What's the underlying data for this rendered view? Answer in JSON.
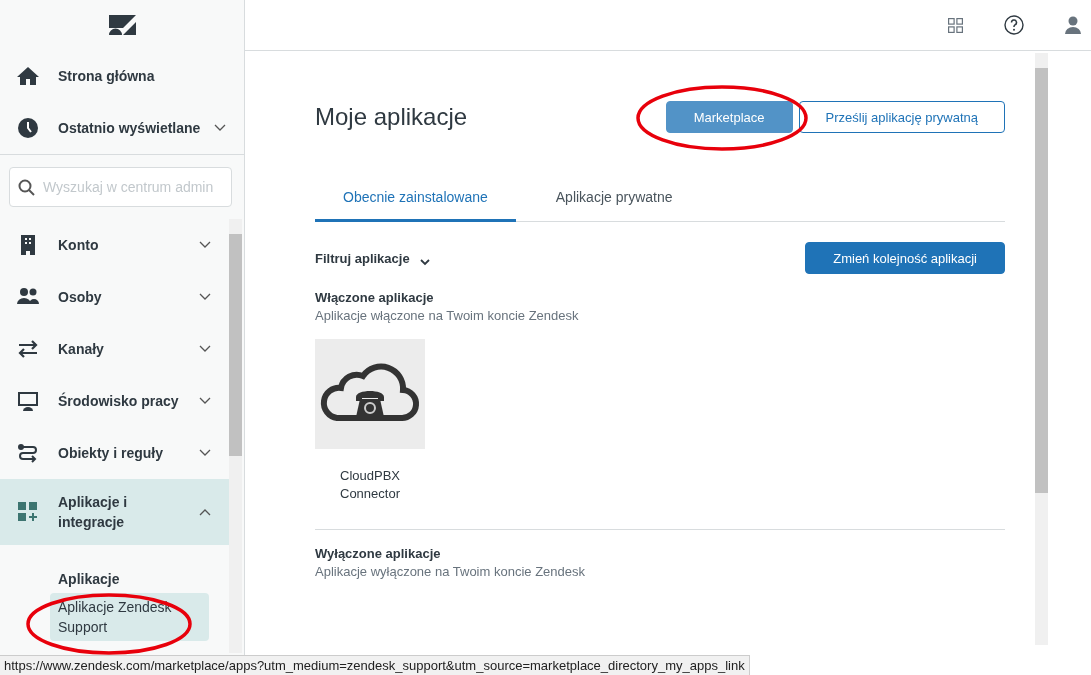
{
  "sidebar": {
    "top_items": [
      {
        "label": "Strona główna",
        "kind": "link"
      },
      {
        "label": "Ostatnio wyświetlane",
        "kind": "group",
        "expanded": false
      }
    ],
    "search": {
      "placeholder": "Wyszukaj w centrum admin"
    },
    "items": [
      {
        "label": "Konto",
        "expanded": false
      },
      {
        "label": "Osoby",
        "expanded": false
      },
      {
        "label": "Kanały",
        "expanded": false
      },
      {
        "label": "Środowisko pracy",
        "expanded": false
      },
      {
        "label": "Obiekty i reguły",
        "expanded": false
      },
      {
        "label": "Aplikacje i integracje",
        "expanded": true,
        "children": [
          {
            "label": "Aplikacje",
            "kind": "heading"
          },
          {
            "label": "Aplikacje Zendesk Support",
            "kind": "link",
            "selected": true
          }
        ]
      }
    ]
  },
  "page": {
    "title": "Moje aplikacje",
    "buttons": [
      {
        "label": "Marketplace",
        "kind": "primary"
      },
      {
        "label": "Prześlij aplikację prywatną",
        "kind": "outline"
      }
    ],
    "tabs": [
      {
        "label": "Obecnie zainstalowane",
        "selected": true
      },
      {
        "label": "Aplikacje prywatne",
        "selected": false
      }
    ],
    "filter": "Filtruj aplikacje",
    "reorder_button": "Zmień kolejność aplikacji",
    "sections": [
      {
        "title": "Włączone aplikacje",
        "subtitle": "Aplikacje włączone na Twoim koncie Zendesk",
        "apps": [
          {
            "name": "CloudPBX Connector"
          }
        ]
      },
      {
        "title": "Wyłączone aplikacje",
        "subtitle": "Aplikacje wyłączone na Twoim koncie Zendesk"
      }
    ]
  },
  "status_bar": {
    "url": "https://www.zendesk.com/marketplace/apps?utm_medium=zendesk_support&utm_source=marketplace_directory_my_apps_link"
  }
}
